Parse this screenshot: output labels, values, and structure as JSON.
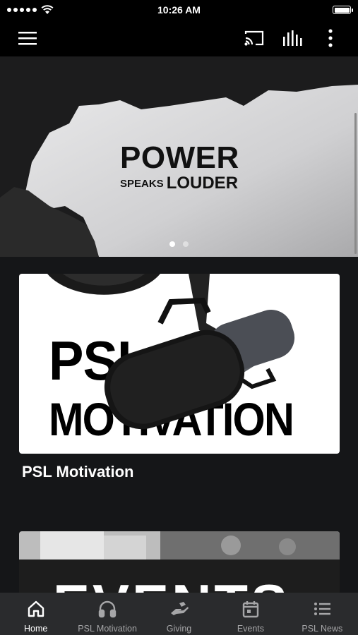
{
  "status_bar": {
    "time": "10:26 AM",
    "signal_dots": 5,
    "battery_level": 1.0
  },
  "app_bar": {
    "menu_icon": "hamburger-menu-icon",
    "cast_icon": "cast-icon",
    "audio_icon": "equalizer-icon",
    "more_icon": "more-vertical-icon"
  },
  "hero": {
    "line1": "POWER",
    "line2_small": "SPEAKS",
    "line2_big": "LOUDER",
    "page_count": 2,
    "active_page": 1
  },
  "cards": [
    {
      "image_line1": "PSL",
      "image_line2": "MOTIVATION",
      "title": "PSL Motivation"
    },
    {
      "image_text": "EVENTS"
    }
  ],
  "tabs": [
    {
      "label": "Home",
      "icon": "home-icon",
      "active": true
    },
    {
      "label": "PSL Motivation",
      "icon": "headphones-icon",
      "active": false
    },
    {
      "label": "Giving",
      "icon": "giving-hand-icon",
      "active": false
    },
    {
      "label": "Events",
      "icon": "calendar-icon",
      "active": false
    },
    {
      "label": "PSL News",
      "icon": "list-icon",
      "active": false
    }
  ],
  "colors": {
    "background": "#151618",
    "bars": "#000000",
    "tab_bar": "#2a2b2d",
    "inactive_tab": "#a6a6a8"
  }
}
